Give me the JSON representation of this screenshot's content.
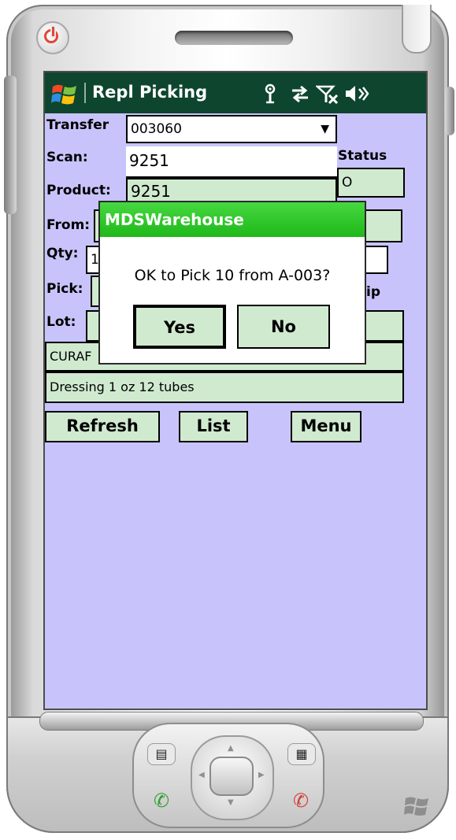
{
  "app": {
    "title": "Repl Picking",
    "accent": "#0e452e",
    "screen_background": "#c8c4fb",
    "field_color": "#d0ead0"
  },
  "status_icons": [
    "antenna-icon",
    "sync-arrows-icon",
    "signal-off-icon",
    "speaker-icon"
  ],
  "form": {
    "transfer": {
      "label": "Transfer",
      "value": "003060"
    },
    "scan": {
      "label": "Scan:",
      "value": "9251"
    },
    "product": {
      "label": "Product:",
      "value": "9251"
    },
    "status": {
      "label": "Status",
      "value": "O"
    },
    "from": {
      "label": "From:"
    },
    "qty": {
      "label": "Qty:",
      "value": "1"
    },
    "pick": {
      "label": "Pick:"
    },
    "skip": {
      "label": "ip"
    },
    "lot": {
      "label": "Lot:"
    },
    "description1": "CURAF",
    "description2": "Dressing 1 oz  12 tubes"
  },
  "buttons": {
    "refresh": "Refresh",
    "list": "List",
    "menu": "Menu"
  },
  "dialog": {
    "title": "MDSWarehouse",
    "message": "OK to Pick 10 from A-003?",
    "yes": "Yes",
    "no": "No",
    "title_color": "#2bc226"
  }
}
